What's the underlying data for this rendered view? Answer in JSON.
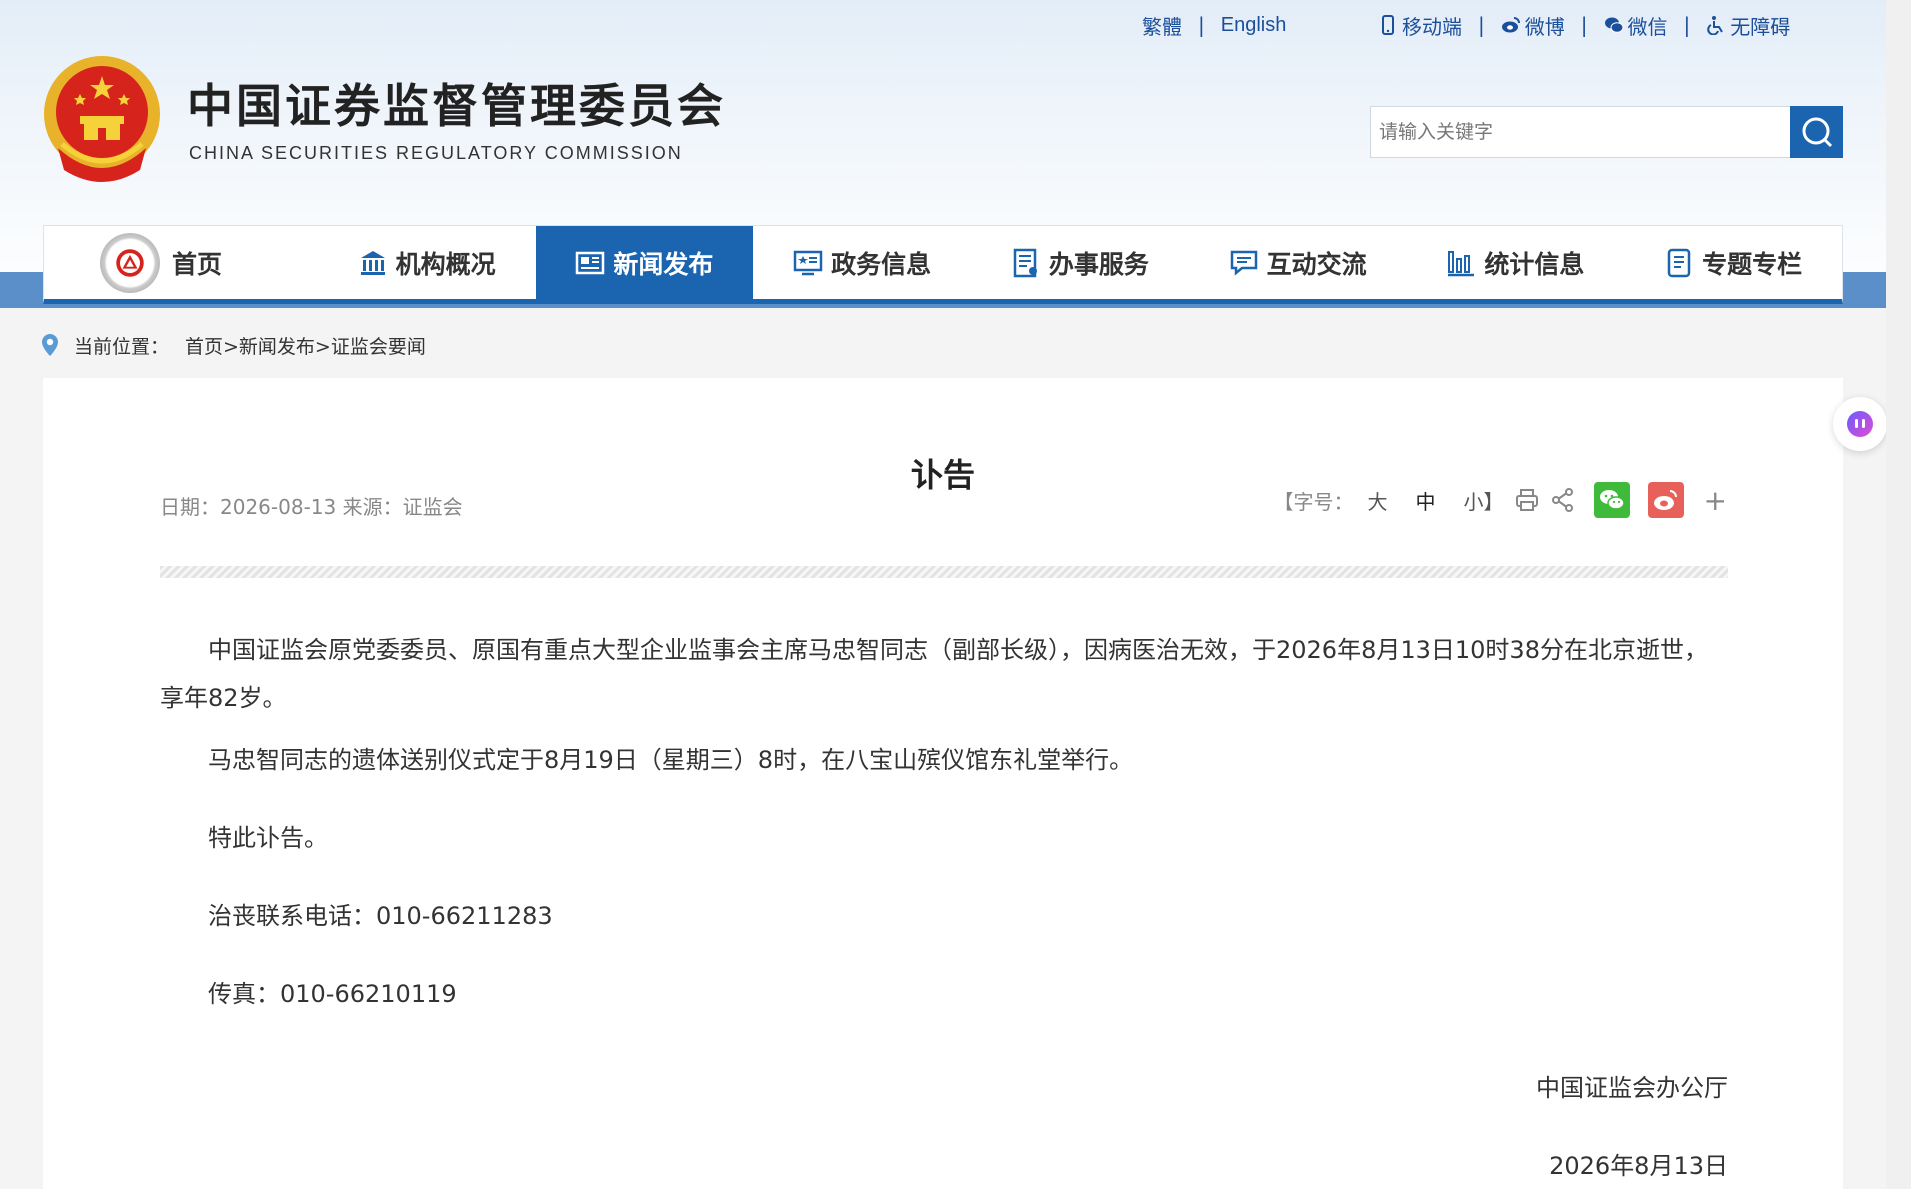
{
  "toplinks": {
    "traditional": "繁體",
    "english": "English",
    "mobile": "移动端",
    "weibo": "微博",
    "wechat": "微信",
    "accessibility": "无障碍",
    "sep": "|"
  },
  "brand": {
    "title": "中国证券监督管理委员会",
    "subtitle": "CHINA SECURITIES REGULATORY COMMISSION"
  },
  "search": {
    "placeholder": "请输入关键字"
  },
  "nav": [
    {
      "label": "首页",
      "icon": "home-logo"
    },
    {
      "label": "机构概况",
      "icon": "institution-icon"
    },
    {
      "label": "新闻发布",
      "icon": "news-icon"
    },
    {
      "label": "政务信息",
      "icon": "gov-info-icon"
    },
    {
      "label": "办事服务",
      "icon": "service-icon"
    },
    {
      "label": "互动交流",
      "icon": "chat-icon"
    },
    {
      "label": "统计信息",
      "icon": "stats-icon"
    },
    {
      "label": "专题专栏",
      "icon": "topic-icon"
    }
  ],
  "nav_active": "新闻发布",
  "breadcrumb": {
    "label": "当前位置：",
    "path": "首页>新闻发布>证监会要闻"
  },
  "article": {
    "title": "讣告",
    "meta": "日期：2026-08-13  来源：证监会",
    "font_size_label": "【字号：",
    "font_large": "大",
    "font_mid": "中",
    "font_small": "小】",
    "paragraphs": [
      "中国证监会原党委委员、原国有重点大型企业监事会主席马忠智同志（副部长级），因病医治无效，于2026年8月13日10时38分在北京逝世，享年82岁。",
      "马忠智同志的遗体送别仪式定于8月19日（星期三）8时，在八宝山殡仪馆东礼堂举行。",
      "特此讣告。",
      "治丧联系电话：010-66211283",
      "传真：010-66210119"
    ],
    "signature": "中国证监会办公厅",
    "sign_date": "2026年8月13日"
  },
  "colors": {
    "primary": "#1a64b0",
    "band": "#5b8fc9",
    "wechat": "#3fba3b",
    "weibo": "#e8605a"
  }
}
